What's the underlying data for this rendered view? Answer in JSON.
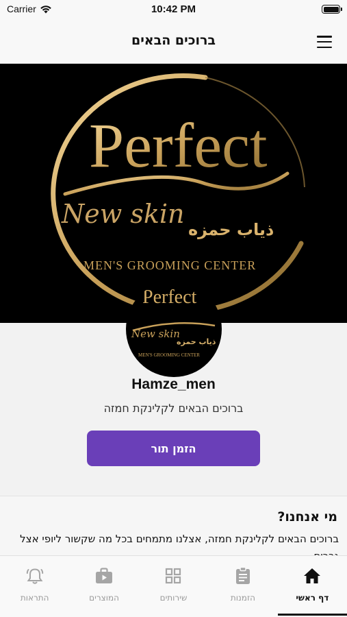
{
  "status_bar": {
    "carrier": "Carrier",
    "time": "10:42 PM"
  },
  "nav": {
    "title": "ברוכים הבאים",
    "menu_icon": "hamburger-menu-icon"
  },
  "cover": {
    "logo_word": "Perfect",
    "logo_script": "New skin",
    "logo_arabic": "ذياب حمزه",
    "logo_tagline": "MEN'S GROOMING CENTER"
  },
  "profile": {
    "name": "Hamze_men",
    "subtitle": "ברוכים הבאים לקלינקת חמזה",
    "book_button": "הזמן תור"
  },
  "about": {
    "title": "מי אנחנו?",
    "text": "ברוכים הבאים לקלינקת חמזה, אצלנו מתמחים בכל מה שקשור ליופי אצל גברים"
  },
  "tabs": [
    {
      "label": "דף ראשי",
      "icon": "home-icon",
      "active": true
    },
    {
      "label": "הזמנות",
      "icon": "clipboard-icon",
      "active": false
    },
    {
      "label": "שירותים",
      "icon": "grid-icon",
      "active": false
    },
    {
      "label": "המוצרים",
      "icon": "shopping-bag-icon",
      "active": false
    },
    {
      "label": "התראות",
      "icon": "bell-icon",
      "active": false
    }
  ],
  "colors": {
    "accent": "#6a3fb8",
    "gold": "#c9a15a",
    "tab_inactive": "#9a9a9a"
  }
}
